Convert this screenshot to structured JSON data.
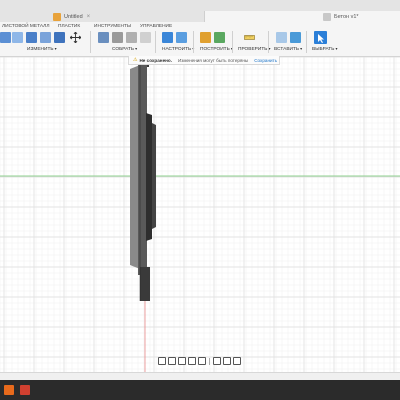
{
  "tabs": [
    {
      "label": "Untitled",
      "icon": "document-icon",
      "active": false
    },
    {
      "label": "Бетон v1*",
      "icon": "document-icon",
      "active": true
    }
  ],
  "ribbon": {
    "tabs": [
      "ЛИСТОВОЙ МЕТАЛЛ",
      "ПЛАСТИК",
      "ИНСТРУМЕНТЫ",
      "УПРАВЛЕНИЕ"
    ],
    "groups": {
      "modify": "ИЗМЕНИТЬ",
      "assemble": "СОБРАТЬ",
      "configure": "НАСТРОИТЬ",
      "construct": "ПОСТРОИТЬ",
      "inspect": "ПРОВЕРИТЬ",
      "insert": "ВСТАВИТЬ",
      "select": "ВЫБРАТЬ"
    }
  },
  "notice": {
    "status": "Не сохранено.",
    "message": "Изменения могут быть потеряны",
    "action": "Сохранить"
  },
  "colors": {
    "accent": "#1a73c8",
    "warning": "#d4a000",
    "grid_major": "#dcdcdc",
    "grid_minor": "#efefef",
    "x_axis": "#8fd08f",
    "z_axis": "#e88888"
  }
}
